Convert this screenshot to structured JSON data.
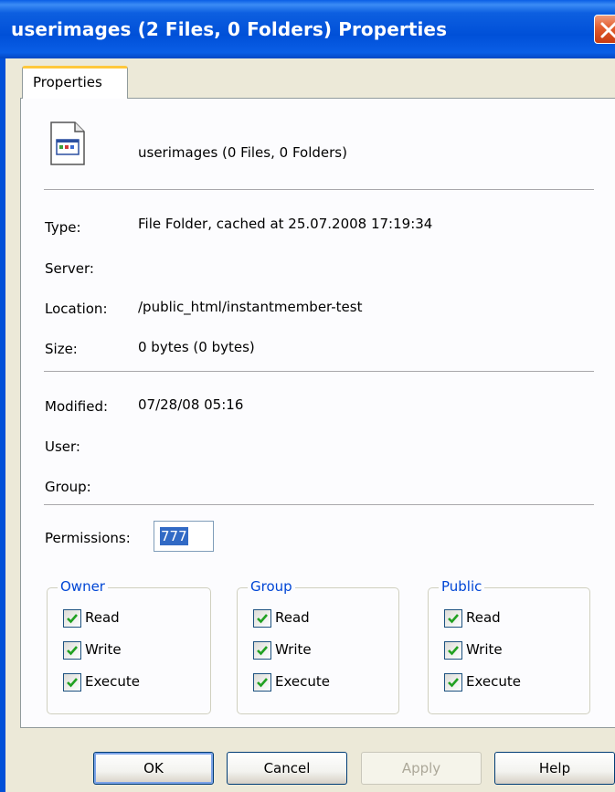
{
  "window": {
    "title": "userimages (2 Files, 0 Folders) Properties"
  },
  "tabs": [
    {
      "label": "Properties"
    }
  ],
  "header": {
    "icon": "file-folder-icon",
    "name": "userimages (0 Files, 0 Folders)"
  },
  "info": {
    "type_label": "Type:",
    "type_value": "File Folder, cached at 25.07.2008 17:19:34",
    "server_label": "Server:",
    "server_value": "",
    "location_label": "Location:",
    "location_value": "/public_html/instantmember-test",
    "size_label": "Size:",
    "size_value": "0 bytes (0 bytes)",
    "modified_label": "Modified:",
    "modified_value": "07/28/08 05:16",
    "user_label": "User:",
    "user_value": "",
    "group_label": "Group:",
    "group_value": ""
  },
  "permissions": {
    "label": "Permissions:",
    "value": "777",
    "groups": [
      {
        "title": "Owner",
        "read": "Read",
        "write": "Write",
        "execute": "Execute",
        "read_checked": true,
        "write_checked": true,
        "execute_checked": true
      },
      {
        "title": "Group",
        "read": "Read",
        "write": "Write",
        "execute": "Execute",
        "read_checked": true,
        "write_checked": true,
        "execute_checked": true
      },
      {
        "title": "Public",
        "read": "Read",
        "write": "Write",
        "execute": "Execute",
        "read_checked": true,
        "write_checked": true,
        "execute_checked": true
      }
    ]
  },
  "buttons": {
    "ok": "OK",
    "cancel": "Cancel",
    "apply": "Apply",
    "help": "Help"
  },
  "colors": {
    "titlebar": "#0050d8",
    "group_title": "#0046d5",
    "selection": "#316ac5"
  }
}
